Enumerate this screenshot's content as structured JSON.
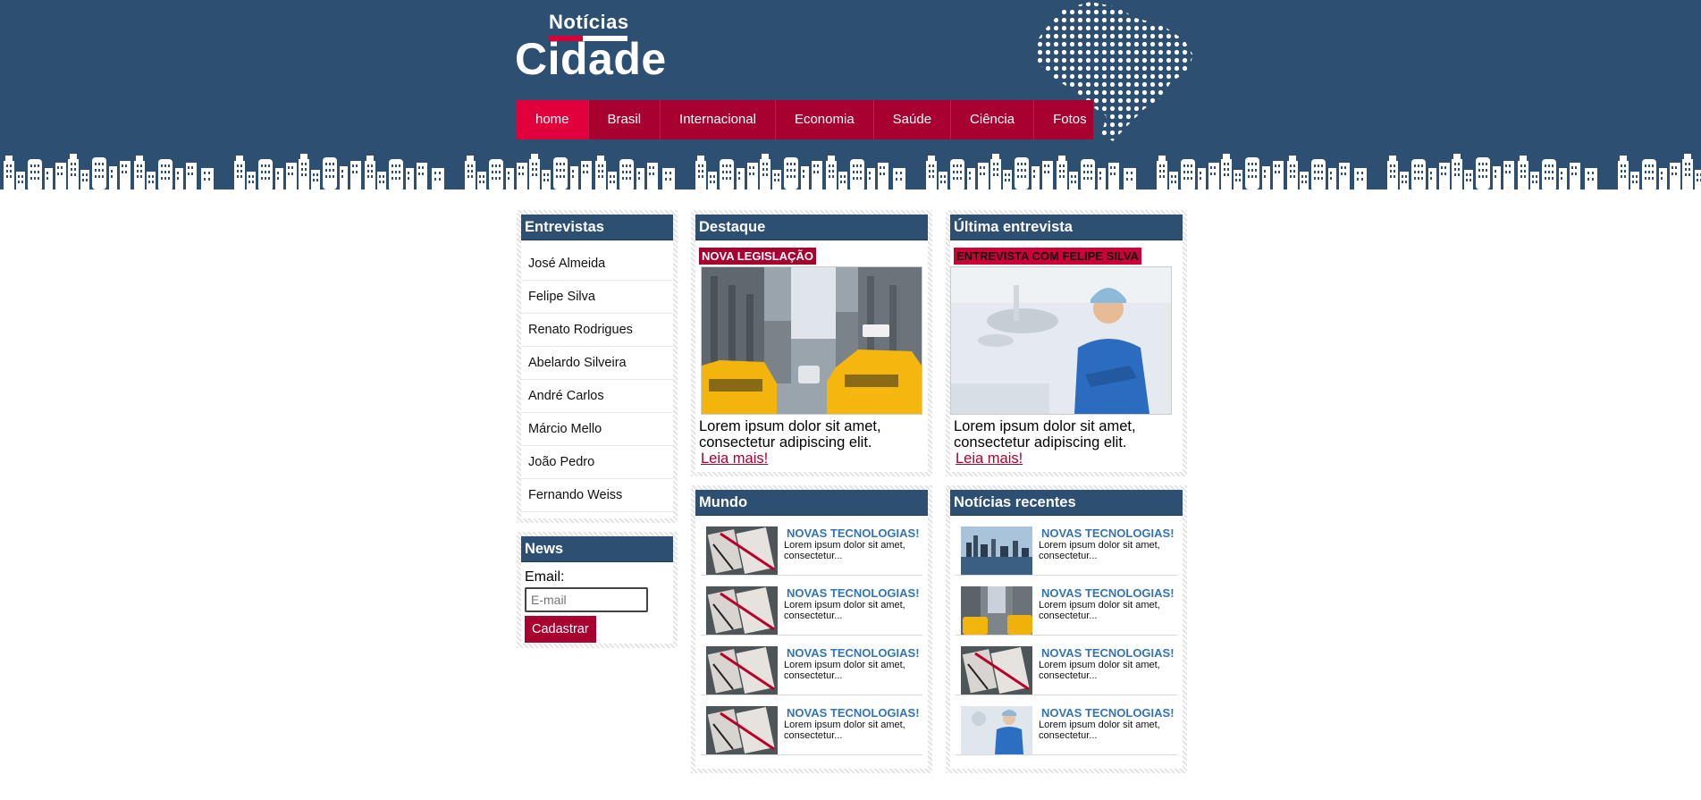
{
  "header": {
    "logo_small": "Notícias",
    "logo_big": "Cidade"
  },
  "nav": [
    "home",
    "Brasil",
    "Internacional",
    "Economia",
    "Saúde",
    "Ciência",
    "Fotos"
  ],
  "entrevistas": {
    "title": "Entrevistas",
    "items": [
      "José Almeida",
      "Felipe Silva",
      "Renato Rodrigues",
      "Abelardo Silveira",
      "André Carlos",
      "Márcio Mello",
      "João Pedro",
      "Fernando Weiss"
    ]
  },
  "news": {
    "title": "News",
    "email_label": "Email:",
    "email_placeholder": "E-mail",
    "button": "Cadastrar"
  },
  "destaque": {
    "title": "Destaque",
    "tag": "NOVA LEGISLAÇÃO",
    "text": "Lorem ipsum dolor sit amet, consectetur adipiscing elit.",
    "link": "Leia mais!"
  },
  "ultima": {
    "title": "Última entrevista",
    "tag": "ENTREVISTA COM FELIPE SILVA",
    "text": "Lorem ipsum dolor sit amet, consectetur adipiscing elit.",
    "link": "Leia mais!"
  },
  "mundo": {
    "title": "Mundo",
    "items": [
      {
        "headline": "NOVAS TECNOLOGIAS!",
        "text": "Lorem ipsum dolor sit amet, consectetur...",
        "thumb": "notebook"
      },
      {
        "headline": "NOVAS TECNOLOGIAS!",
        "text": "Lorem ipsum dolor sit amet, consectetur...",
        "thumb": "notebook"
      },
      {
        "headline": "NOVAS TECNOLOGIAS!",
        "text": "Lorem ipsum dolor sit amet, consectetur...",
        "thumb": "notebook"
      },
      {
        "headline": "NOVAS TECNOLOGIAS!",
        "text": "Lorem ipsum dolor sit amet, consectetur...",
        "thumb": "notebook"
      }
    ]
  },
  "recentes": {
    "title": "Notícias recentes",
    "items": [
      {
        "headline": "NOVAS TECNOLOGIAS!",
        "text": "Lorem ipsum dolor sit amet, consectetur...",
        "thumb": "skyline"
      },
      {
        "headline": "NOVAS TECNOLOGIAS!",
        "text": "Lorem ipsum dolor sit amet, consectetur...",
        "thumb": "taxi"
      },
      {
        "headline": "NOVAS TECNOLOGIAS!",
        "text": "Lorem ipsum dolor sit amet, consectetur...",
        "thumb": "notebook"
      },
      {
        "headline": "NOVAS TECNOLOGIAS!",
        "text": "Lorem ipsum dolor sit amet, consectetur...",
        "thumb": "doctor"
      }
    ]
  },
  "colors": {
    "header_blue": "#2c4f72",
    "nav_red": "#a8002f",
    "nav_active": "#e2003c",
    "headline_blue": "#3274b4"
  }
}
